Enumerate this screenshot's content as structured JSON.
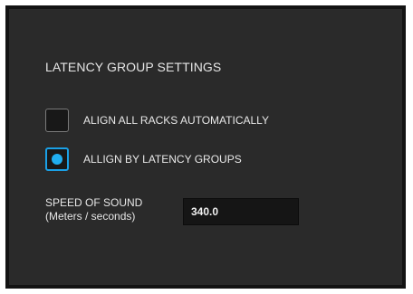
{
  "panel": {
    "title": "LATENCY GROUP SETTINGS",
    "options": [
      {
        "label": "ALIGN ALL RACKS AUTOMATICALLY",
        "selected": false
      },
      {
        "label": "ALLIGN BY LATENCY GROUPS",
        "selected": true
      }
    ],
    "speed": {
      "label_line1": "SPEED OF SOUND",
      "label_line2": "(Meters / seconds)",
      "value": "340.0"
    }
  },
  "colors": {
    "panel_background": "#2a2a2a",
    "accent": "#1aa0e6"
  }
}
